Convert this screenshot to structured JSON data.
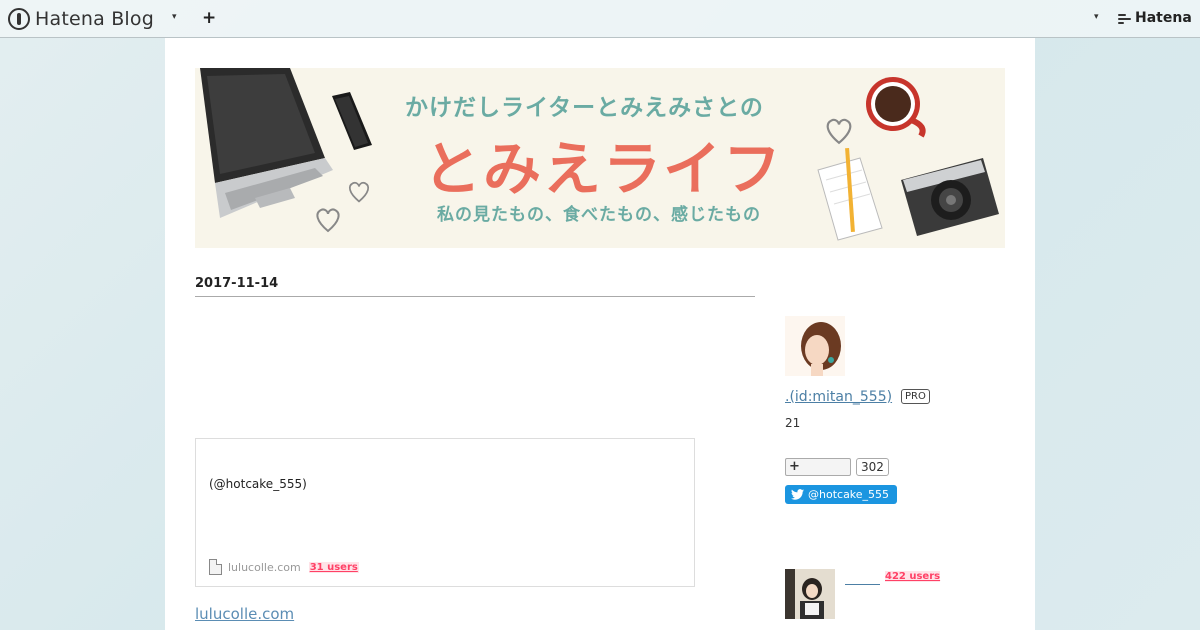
{
  "topbar": {
    "logo_text": "Hatena Blog",
    "menu_caret": "▾",
    "add_label": "+",
    "account_caret": "▾",
    "hatena_label": "Hatena"
  },
  "banner": {
    "line1": "かけだしライターとみえみさとの",
    "title": "とみえライフ",
    "line3": "私の見たもの、食べたもの、感じたもの"
  },
  "entry": {
    "date": "2017-11-14",
    "embed": {
      "text": "(@hotcake_555)",
      "site": "lulucolle.com",
      "users": "31 users"
    },
    "link": "lulucolle.com"
  },
  "sidebar": {
    "profile_name": ".(id:mitan_555)",
    "pro_badge": "PRO",
    "count": "21",
    "follow_label": "+",
    "follow_count": "302",
    "twitter_label": "@hotcake_555",
    "related_users": "422 users"
  },
  "colors": {
    "accent_teal": "#6aaba3",
    "accent_coral": "#ea6e5c",
    "link_blue": "#4c7fa5",
    "twitter_blue": "#1b95e0",
    "bookmark_red": "#ff4166"
  }
}
